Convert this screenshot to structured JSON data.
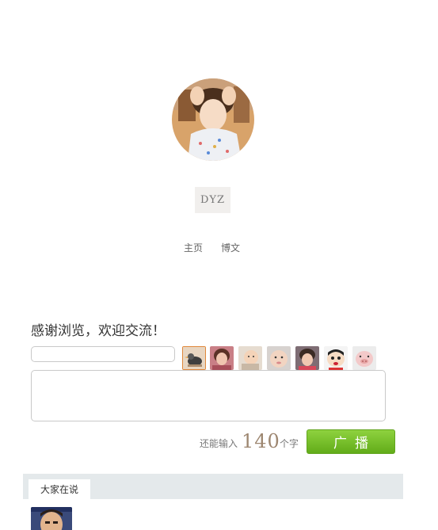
{
  "profile": {
    "name": "DYZ"
  },
  "nav": {
    "items": [
      {
        "label": "主页"
      },
      {
        "label": "博文"
      }
    ]
  },
  "message_board": {
    "title": "感谢浏览，欢迎交流！",
    "name_input": {
      "value": "",
      "placeholder": ""
    },
    "textarea": {
      "value": "",
      "placeholder": ""
    },
    "faces": [
      "duck-face",
      "girl-face-1",
      "baby-face-1",
      "baby-face-2",
      "girl-face-2",
      "crayon-shin-chan-face",
      "pig-face"
    ],
    "selected_face": "duck-face",
    "counter": {
      "prefix": "还能输入",
      "remaining": "140",
      "suffix": "个字"
    },
    "submit_label": "广播"
  },
  "tabs": {
    "active_label": "大家在说"
  },
  "colors": {
    "accent_green": "#6cb824",
    "counter_brown": "#9d8670",
    "tabbar_bg": "#e4e9eb"
  }
}
